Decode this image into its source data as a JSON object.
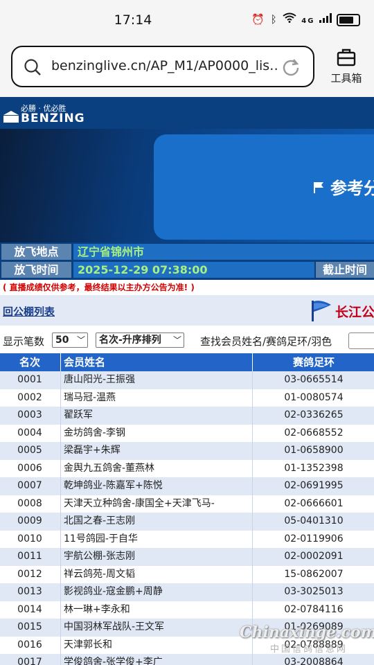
{
  "status_bar": {
    "time": "17:14",
    "icons": [
      "alarm-icon",
      "bluetooth-icon",
      "wifi-icon",
      "4g-signal-icon",
      "battery-icon"
    ],
    "network": "4G"
  },
  "browser": {
    "url": "benzinglive.cn/AP_M1/AP0000_lis…",
    "toolbox_label": "工具箱"
  },
  "site": {
    "slogan": "必勝 · 优必胜",
    "brand": "BENZING",
    "banner_title": "参考分"
  },
  "info": {
    "release_place_label": "放飞地点",
    "release_place_value": "辽宁省锦州市",
    "release_time_label": "放飞时间",
    "release_time_value": "2025-12-29 07:38:00",
    "cutoff_label": "截止时间"
  },
  "notice": "( 直播成绩仅供参考，最终结果以主办方公告为准! )",
  "nav": {
    "back_link": "回公棚列表",
    "loft_name": "长江公"
  },
  "controls": {
    "show_count_label": "显示笔数",
    "show_count_value": "50",
    "sort_value": "名次-升序排列",
    "search_label": "查找会员姓名/赛鸽足环/羽色"
  },
  "table": {
    "headers": {
      "rank": "名次",
      "name": "会员姓名",
      "ring": "赛鸽足环"
    },
    "rows": [
      {
        "rank": "0001",
        "name": "唐山阳光-王振强",
        "ring": "03-0665514"
      },
      {
        "rank": "0002",
        "name": "瑞马冠-温燕",
        "ring": "01-0080574"
      },
      {
        "rank": "0003",
        "name": "翟跃军",
        "ring": "02-0336265"
      },
      {
        "rank": "0004",
        "name": "金坊鸽舍-李钢",
        "ring": "02-0668552"
      },
      {
        "rank": "0005",
        "name": "梁磊宇+朱辉",
        "ring": "01-0658900"
      },
      {
        "rank": "0006",
        "name": "金舆九五鸽舍-董燕林",
        "ring": "01-1352398"
      },
      {
        "rank": "0007",
        "name": "乾坤鸽业-陈嘉军+陈悦",
        "ring": "02-0691995"
      },
      {
        "rank": "0008",
        "name": "天津天立种鸽舍-康国全+天津飞马-",
        "ring": "02-0666601"
      },
      {
        "rank": "0009",
        "name": "北国之春-王志刚",
        "ring": "05-0401310"
      },
      {
        "rank": "0010",
        "name": "11号鸽园-于自华",
        "ring": "02-0119906"
      },
      {
        "rank": "0011",
        "name": "宇航公棚-张志刚",
        "ring": "02-0002091"
      },
      {
        "rank": "0012",
        "name": "祥云鸽苑-周文韬",
        "ring": "15-0862007"
      },
      {
        "rank": "0013",
        "name": "影视鸽业-寇金鹏+周静",
        "ring": "03-3025013"
      },
      {
        "rank": "0014",
        "name": "林一琳+李永和",
        "ring": "02-0784116"
      },
      {
        "rank": "0015",
        "name": "中国羽林军战队-王文军",
        "ring": "01-0269089"
      },
      {
        "rank": "0016",
        "name": "天津郭长和",
        "ring": "02-0788889"
      },
      {
        "rank": "0017",
        "name": "学俊鸽舍-张学俊+李广",
        "ring": "03-2008864"
      }
    ]
  },
  "watermark": {
    "main": "Chinaxinge.com",
    "sub": "中国信鸽信息网"
  },
  "colors": {
    "header_blue": "#0a3f80",
    "table_header": "#2364c8",
    "row_alt": "#dfe8f4",
    "notice_red": "#d40000",
    "value_green": "#a8f080"
  }
}
